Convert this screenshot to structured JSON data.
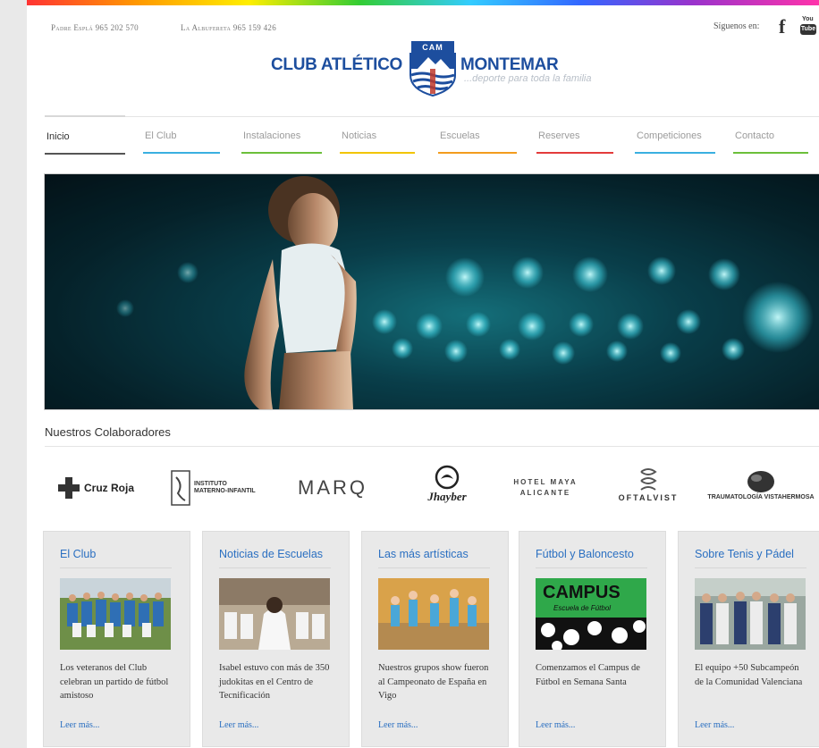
{
  "topbar": {
    "phone1_label": "Padre Esplá",
    "phone1_number": "965 202 570",
    "phone2_label": "La Albufereta",
    "phone2_number": "965 159 426",
    "social_label": "Síguenos en:",
    "facebook_glyph": "f",
    "youtube_top": "You",
    "youtube_bottom": "Tube"
  },
  "logo": {
    "left_text": "CLUB ATLÉTICO",
    "right_text": "MONTEMAR",
    "crest_text": "CAM",
    "tagline": "...deporte para toda la familia"
  },
  "nav": {
    "items": [
      {
        "label": "Inicio",
        "color": "#555555"
      },
      {
        "label": "El Club",
        "color": "#3ab0e0"
      },
      {
        "label": "Instalaciones",
        "color": "#6cbf3a"
      },
      {
        "label": "Noticias",
        "color": "#f2c500"
      },
      {
        "label": "Escuelas",
        "color": "#f39c1e"
      },
      {
        "label": "Reserves",
        "color": "#e33b3b"
      },
      {
        "label": "Competiciones",
        "color": "#3ab0e0"
      },
      {
        "label": "Contacto",
        "color": "#6cbf3a"
      }
    ]
  },
  "collaborators": {
    "title": "Nuestros Colaboradores",
    "items": [
      {
        "name": "Cruz Roja"
      },
      {
        "name": "INSTITUTO MATERNO-INFANTIL"
      },
      {
        "name": "MARQ"
      },
      {
        "name": "Jhayber"
      },
      {
        "name": "HOTEL MAYA ALICANTE"
      },
      {
        "name": "OFTALVIST"
      },
      {
        "name": "TRAUMATOLOGÍA VISTAHERMOSA"
      }
    ]
  },
  "cards": [
    {
      "title": "El Club",
      "text": "Los veteranos del Club celebran un partido de fútbol amistoso",
      "more": "Leer más..."
    },
    {
      "title": "Noticias de Escuelas",
      "text": "Isabel estuvo con más de 350 judokitas en el Centro de Tecnificación",
      "more": "Leer más..."
    },
    {
      "title": "Las más artísticas",
      "text": "Nuestros grupos show fueron al Campeonato de España en Vigo",
      "more": "Leer más..."
    },
    {
      "title": "Fútbol y Baloncesto",
      "text": "Comenzamos el Campus de Fútbol en Semana Santa",
      "more": "Leer más...",
      "img_text1": "CAMPUS",
      "img_text2": "Escuela de Fútbol"
    },
    {
      "title": "Sobre Tenis y Pádel",
      "text": "El equipo +50 Subcampeón de la Comunidad Valenciana",
      "more": "Leer más..."
    }
  ],
  "colors": {
    "brand_blue": "#1d4e9e",
    "link_blue": "#2a6fc1",
    "card_bg": "#e9e9e9"
  }
}
